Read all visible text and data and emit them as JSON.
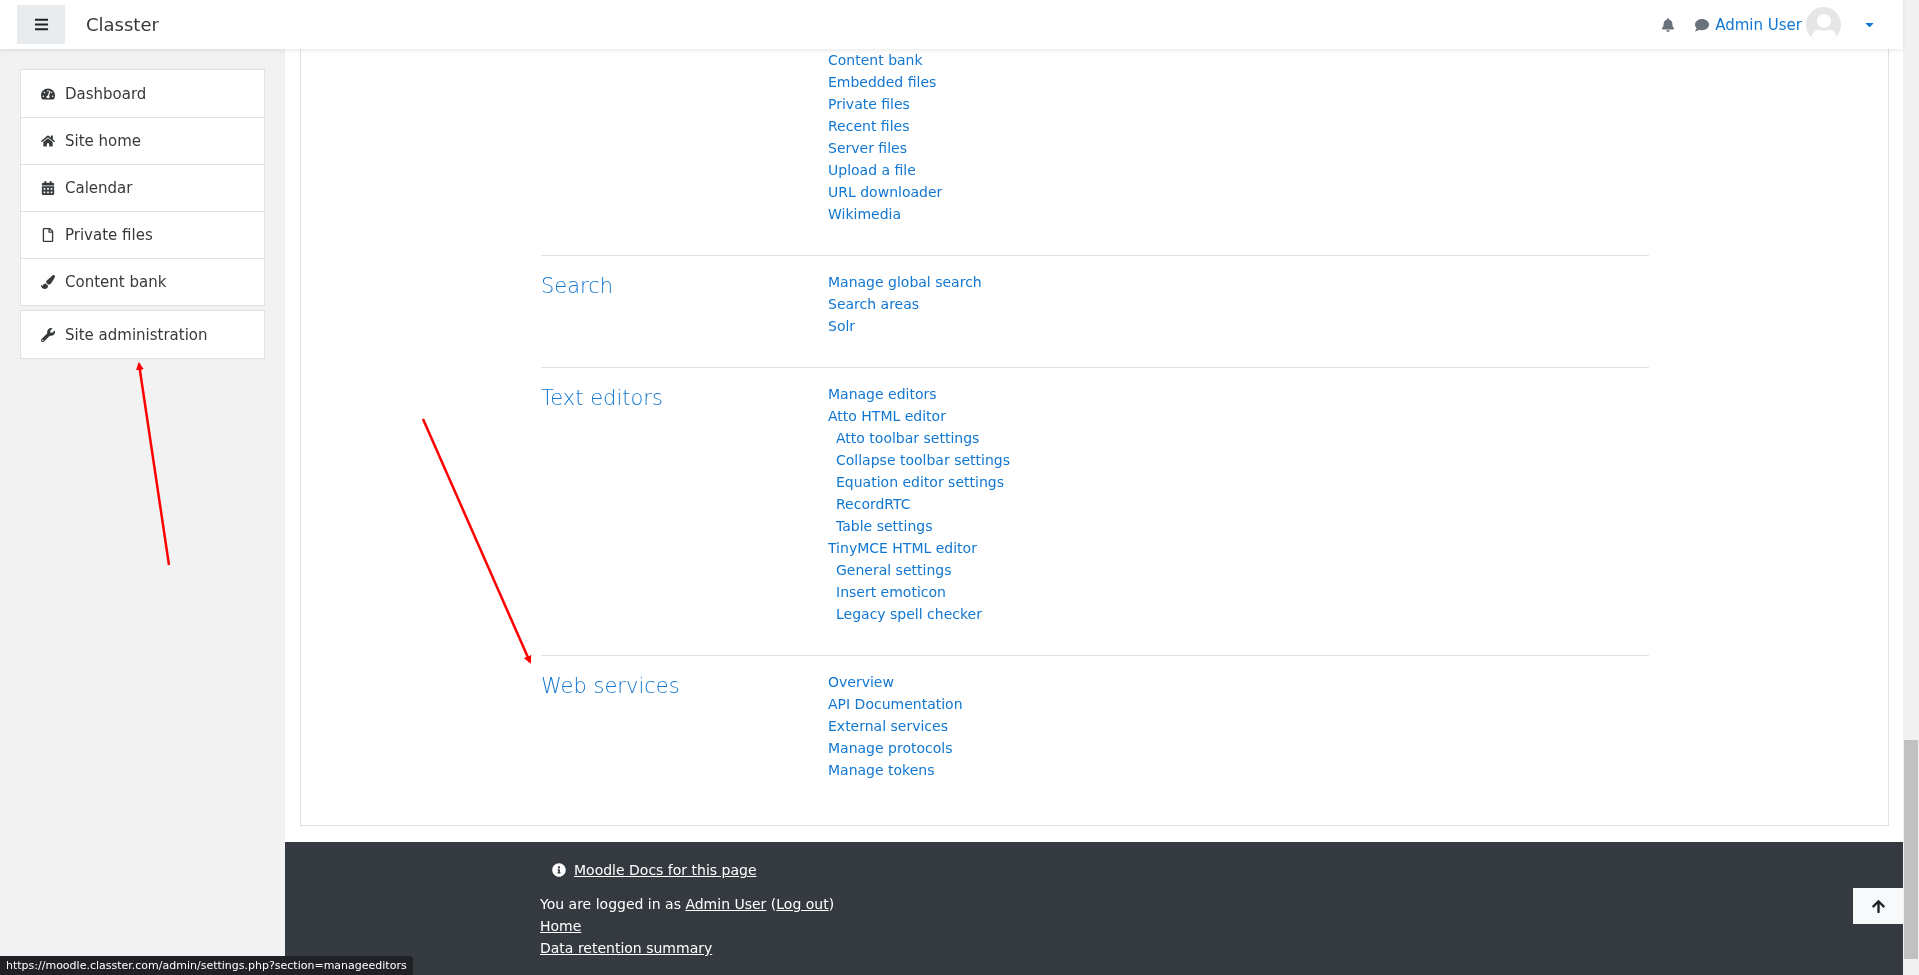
{
  "header": {
    "brand": "Classter",
    "user_name": "Admin User"
  },
  "sidebar": {
    "groups": [
      {
        "items": [
          {
            "label": "Dashboard"
          },
          {
            "label": "Site home"
          },
          {
            "label": "Calendar"
          },
          {
            "label": "Private files"
          },
          {
            "label": "Content bank"
          }
        ]
      },
      {
        "items": [
          {
            "label": "Site administration"
          }
        ]
      }
    ]
  },
  "sections": [
    {
      "links": [
        {
          "label": "Content bank"
        },
        {
          "label": "Embedded files"
        },
        {
          "label": "Private files"
        },
        {
          "label": "Recent files"
        },
        {
          "label": "Server files"
        },
        {
          "label": "Upload a file"
        },
        {
          "label": "URL downloader"
        },
        {
          "label": "Wikimedia"
        }
      ]
    },
    {
      "heading": "Search",
      "links": [
        {
          "label": "Manage global search"
        },
        {
          "label": "Search areas"
        },
        {
          "label": "Solr"
        }
      ]
    },
    {
      "heading": "Text editors",
      "links": [
        {
          "label": "Manage editors"
        },
        {
          "label": "Atto HTML editor",
          "children": [
            {
              "label": "Atto toolbar settings"
            },
            {
              "label": "Collapse toolbar settings"
            },
            {
              "label": "Equation editor settings"
            },
            {
              "label": "RecordRTC"
            },
            {
              "label": "Table settings"
            }
          ]
        },
        {
          "label": "TinyMCE HTML editor",
          "children": [
            {
              "label": "General settings"
            },
            {
              "label": "Insert emoticon"
            },
            {
              "label": "Legacy spell checker"
            }
          ]
        }
      ]
    },
    {
      "heading": "Web services",
      "links": [
        {
          "label": "Overview"
        },
        {
          "label": "API Documentation"
        },
        {
          "label": "External services"
        },
        {
          "label": "Manage protocols"
        },
        {
          "label": "Manage tokens"
        }
      ]
    }
  ],
  "footer": {
    "docs_link": "Moodle Docs for this page",
    "login": {
      "prefix": "You are logged in as",
      "user": "Admin User",
      "open": "(",
      "logout": "Log out",
      "close": ")"
    },
    "links": [
      "Home",
      "Data retention summary"
    ]
  },
  "status_url": "https://moodle.classter.com/admin/settings.php?section=manageeditors"
}
